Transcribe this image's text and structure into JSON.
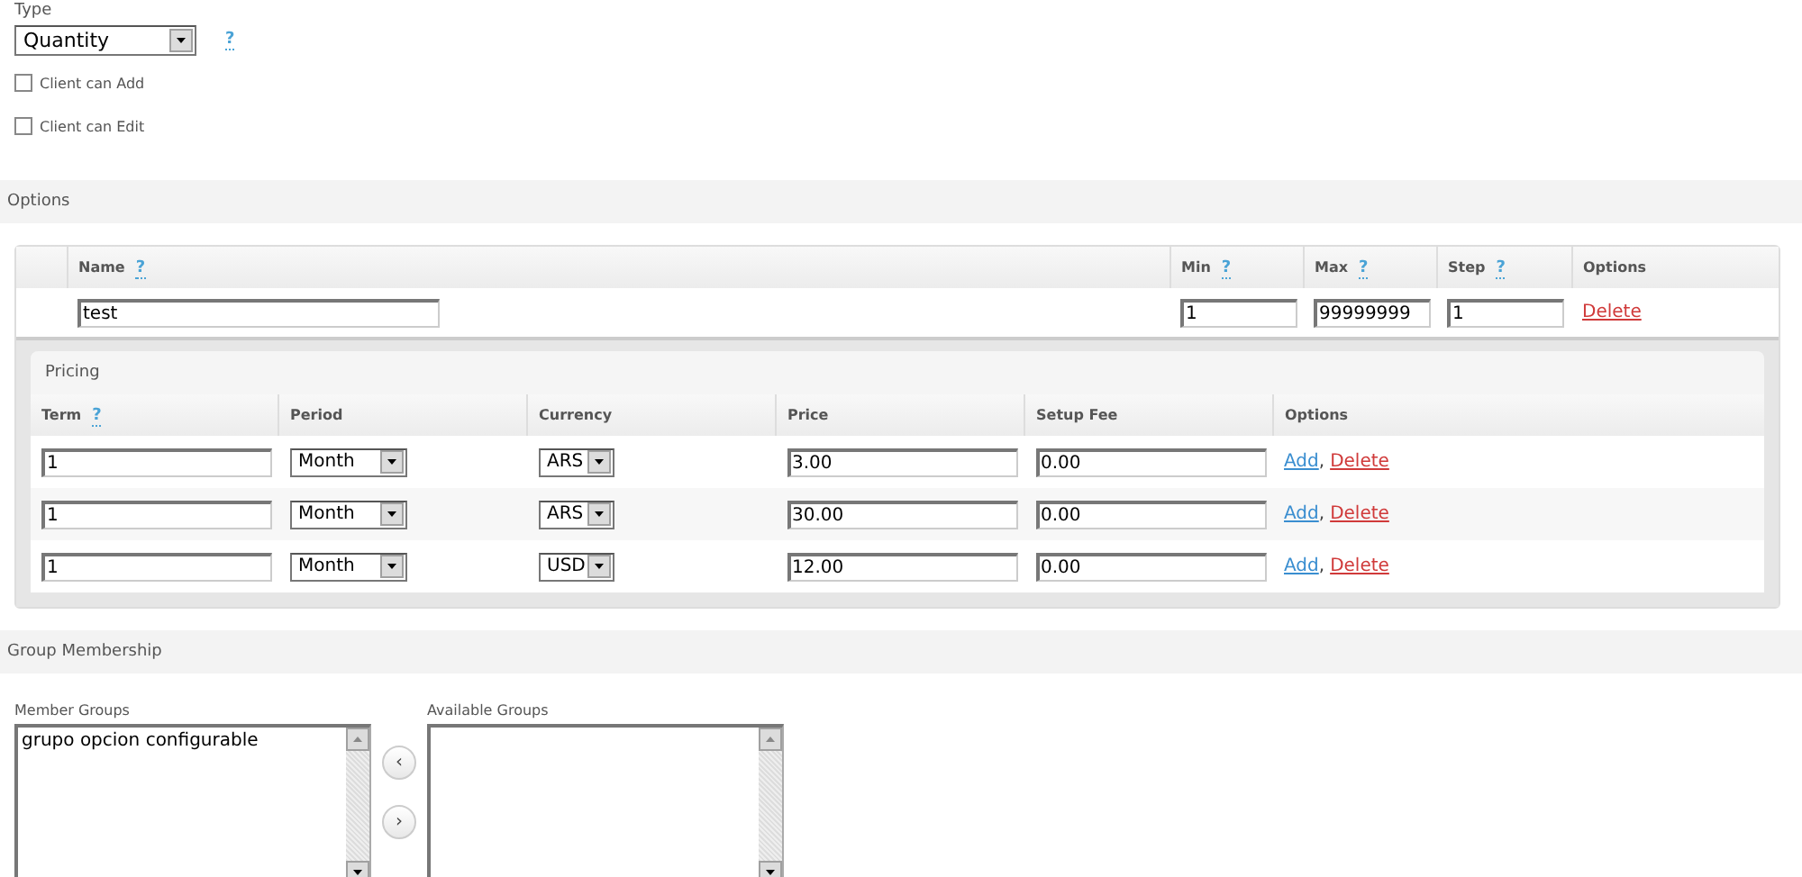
{
  "type_field": {
    "label": "Type",
    "value": "Quantity",
    "help": "?"
  },
  "checkboxes": [
    {
      "label": "Client can Add",
      "checked": false
    },
    {
      "label": "Client can Edit",
      "checked": false
    }
  ],
  "options_section": {
    "title": "Options",
    "columns": [
      {
        "label": "Name",
        "help": "?"
      },
      {
        "label": "Min",
        "help": "?"
      },
      {
        "label": "Max",
        "help": "?"
      },
      {
        "label": "Step",
        "help": "?"
      },
      {
        "label": "Options"
      }
    ],
    "rows": [
      {
        "name": "test",
        "min": "1",
        "max": "99999999",
        "step": "1",
        "action": "Delete"
      }
    ],
    "pricing": {
      "title": "Pricing",
      "columns": [
        {
          "label": "Term",
          "help": "?"
        },
        {
          "label": "Period"
        },
        {
          "label": "Currency"
        },
        {
          "label": "Price"
        },
        {
          "label": "Setup Fee"
        },
        {
          "label": "Options"
        }
      ],
      "rows": [
        {
          "term": "1",
          "period": "Month",
          "currency": "ARS",
          "price": "3.00",
          "setup_fee": "0.00",
          "actions": [
            {
              "kind": "add",
              "label": "Add"
            },
            {
              "kind": "delete",
              "label": "Delete"
            }
          ],
          "separator": ","
        },
        {
          "term": "1",
          "period": "Month",
          "currency": "ARS",
          "price": "30.00",
          "setup_fee": "0.00",
          "actions": [
            {
              "kind": "add",
              "label": "Add"
            },
            {
              "kind": "delete",
              "label": "Delete"
            }
          ],
          "separator": ","
        },
        {
          "term": "1",
          "period": "Month",
          "currency": "USD",
          "price": "12.00",
          "setup_fee": "0.00",
          "actions": [
            {
              "kind": "add",
              "label": "Add"
            },
            {
              "kind": "delete",
              "label": "Delete"
            }
          ],
          "separator": ","
        }
      ]
    }
  },
  "group_membership": {
    "title": "Group Membership",
    "member_groups": {
      "label": "Member Groups",
      "items": [
        {
          "label": "grupo opcion configurable",
          "selected": false
        }
      ]
    },
    "move_buttons": [
      {
        "label": "‹"
      },
      {
        "label": "›"
      }
    ],
    "available_groups": {
      "label": "Available Groups"
    }
  }
}
